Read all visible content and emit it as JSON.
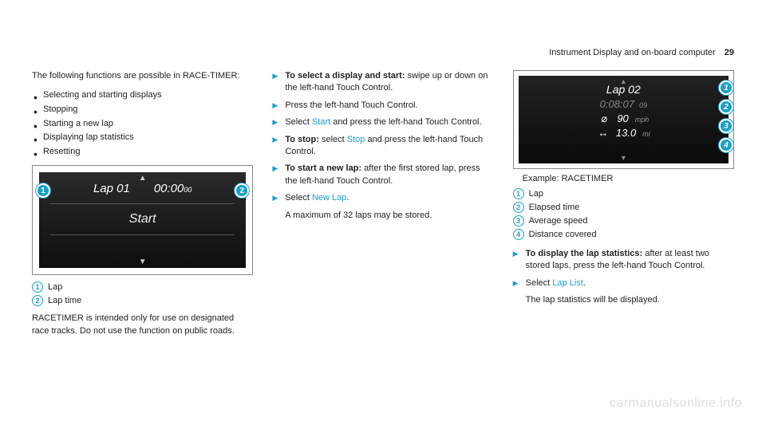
{
  "header": {
    "title": "Instrument Display and on-board computer",
    "page": "29"
  },
  "col1": {
    "intro": "The following functions are possible in RACE-TIMER:",
    "functions": [
      "Selecting and starting displays",
      "Stopping",
      "Starting a new lap",
      "Displaying lap statistics",
      "Resetting"
    ],
    "screen": {
      "lap_label": "Lap 01",
      "time": "00:00",
      "time_sub": "00",
      "start_label": "Start"
    },
    "legend": {
      "1": "Lap",
      "2": "Lap time"
    },
    "note": "RACETIMER is intended only for use on designated race tracks. Do not use the function on public roads."
  },
  "col2": {
    "steps": [
      {
        "bold": "To select a display and start:",
        "rest": " swipe up or down on the left-hand Touch Control."
      },
      {
        "bold": "",
        "rest": "Press the left-hand Touch Control."
      },
      {
        "bold": "",
        "rest_pre": "Select ",
        "link": "Start",
        "rest_post": " and press the left-hand Touch Control."
      },
      {
        "bold": "To stop:",
        "rest_pre": " select ",
        "link": "Stop",
        "rest_post": " and press the left-hand Touch Control."
      },
      {
        "bold": "To start a new lap:",
        "rest": " after the first stored lap, press the left-hand Touch Control."
      },
      {
        "bold": "",
        "rest_pre": "Select ",
        "link": "New Lap",
        "rest_post": "."
      }
    ],
    "sub": "A maximum of 32 laps may be stored."
  },
  "col3": {
    "screen": {
      "lap_label": "Lap 02",
      "time": "0:08:07",
      "time_sub": "09",
      "speed_value": "90",
      "speed_unit": "mph",
      "dist_value": "13.0",
      "dist_unit": "mi"
    },
    "caption": "Example: RACETIMER",
    "legend": {
      "1": "Lap",
      "2": "Elapsed time",
      "3": "Average speed",
      "4": "Distance covered"
    },
    "steps": [
      {
        "bold": "To display the lap statistics:",
        "rest": " after at least two stored laps, press the left-hand Touch Control."
      },
      {
        "bold": "",
        "rest_pre": "Select ",
        "link": "Lap List",
        "rest_post": "."
      }
    ],
    "sub": "The lap statistics will be displayed."
  },
  "watermark": "carmanualsonline.info",
  "callouts": {
    "1": "1",
    "2": "2",
    "3": "3",
    "4": "4"
  }
}
